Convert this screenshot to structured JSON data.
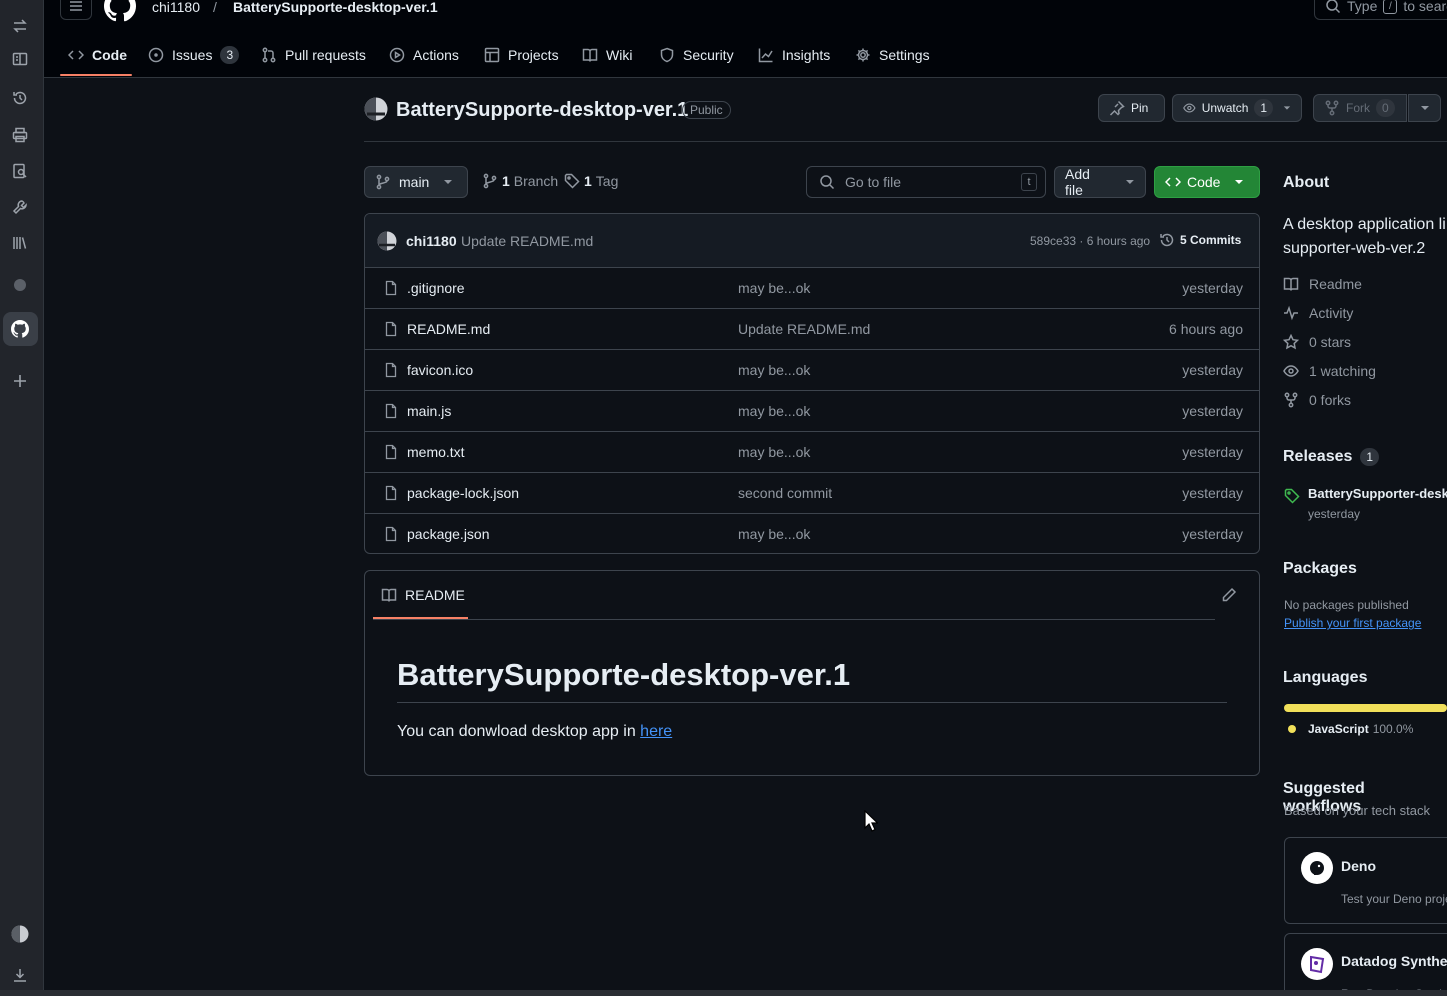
{
  "header": {
    "owner": "chi1180",
    "separator": "/",
    "repo": "BatterySupporte-desktop-ver.1",
    "search_prefix": "Type",
    "search_key": "/",
    "search_suffix": "to search"
  },
  "tabs": [
    {
      "label": "Code",
      "icon": "code-icon"
    },
    {
      "label": "Issues",
      "icon": "issue-icon",
      "count": "3"
    },
    {
      "label": "Pull requests",
      "icon": "pull-request-icon"
    },
    {
      "label": "Actions",
      "icon": "play-icon"
    },
    {
      "label": "Projects",
      "icon": "table-icon"
    },
    {
      "label": "Wiki",
      "icon": "book-icon"
    },
    {
      "label": "Security",
      "icon": "shield-icon"
    },
    {
      "label": "Insights",
      "icon": "graph-icon"
    },
    {
      "label": "Settings",
      "icon": "gear-icon"
    }
  ],
  "repo": {
    "name": "BatterySupporte-desktop-ver.1",
    "visibility": "Public",
    "pin_label": "Pin",
    "watch_label": "Unwatch",
    "watch_count": "1",
    "fork_label": "Fork",
    "fork_count": "0"
  },
  "toolbar": {
    "branch": "main",
    "branch_count": "1",
    "branch_label": "Branch",
    "tag_count": "1",
    "tag_label": "Tag",
    "goto_placeholder": "Go to file",
    "goto_key": "t",
    "add_file": "Add file",
    "code_button": "Code"
  },
  "latest_commit": {
    "author": "chi1180",
    "message": "Update README.md",
    "hash_time": "589ce33 · 6 hours ago",
    "commits_label": "5 Commits"
  },
  "files": [
    {
      "name": ".gitignore",
      "message": "may be...ok",
      "date": "yesterday"
    },
    {
      "name": "README.md",
      "message": "Update README.md",
      "date": "6 hours ago"
    },
    {
      "name": "favicon.ico",
      "message": "may be...ok",
      "date": "yesterday"
    },
    {
      "name": "main.js",
      "message": "may be...ok",
      "date": "yesterday"
    },
    {
      "name": "memo.txt",
      "message": "may be...ok",
      "date": "yesterday"
    },
    {
      "name": "package-lock.json",
      "message": "second commit",
      "date": "yesterday"
    },
    {
      "name": "package.json",
      "message": "may be...ok",
      "date": "yesterday"
    }
  ],
  "readme": {
    "tab_label": "README",
    "heading": "BatterySupporte-desktop-ver.1",
    "text": "You can donwload desktop app in",
    "link": "here"
  },
  "about": {
    "title": "About",
    "description_line1": "A desktop application li",
    "description_line2": "supporter-web-ver.2",
    "links": [
      {
        "label": "Readme",
        "icon": "book-icon"
      },
      {
        "label": "Activity",
        "icon": "pulse-icon"
      },
      {
        "label": "0 stars",
        "icon": "star-icon"
      },
      {
        "label": "1 watching",
        "icon": "eye-icon"
      },
      {
        "label": "0 forks",
        "icon": "fork-icon"
      }
    ]
  },
  "releases": {
    "title": "Releases",
    "count": "1",
    "latest_name": "BatterySupporter-deskt",
    "latest_date": "yesterday"
  },
  "packages": {
    "title": "Packages",
    "empty_text": "No packages published",
    "publish_link": "Publish your first package"
  },
  "languages": {
    "title": "Languages",
    "items": [
      {
        "name": "JavaScript",
        "percent": "100.0%",
        "color": "#f1e05a",
        "share": 1.0
      }
    ]
  },
  "workflows": {
    "title": "Suggested workflows",
    "subtitle": "Based on your tech stack",
    "items": [
      {
        "name": "Deno",
        "desc": "Test your Deno proje"
      },
      {
        "name": "Datadog Synthet",
        "desc": "Run Datadog Synth"
      }
    ]
  },
  "colors": {
    "accent_green": "#238636",
    "link_blue": "#4493f8",
    "tab_underline": "#f78166",
    "js_yellow": "#f1e05a"
  }
}
